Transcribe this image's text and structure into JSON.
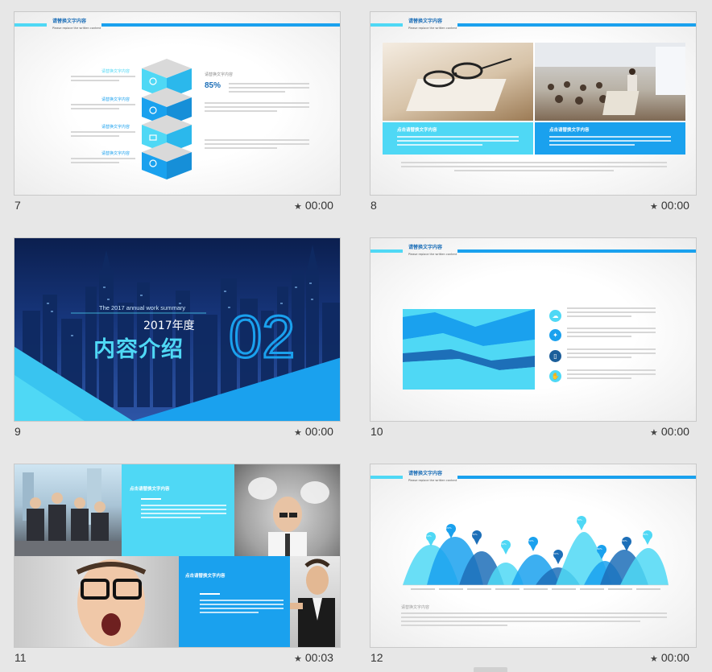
{
  "slides": [
    {
      "number": "7",
      "time": "00:00"
    },
    {
      "number": "8",
      "time": "00:00"
    },
    {
      "number": "9",
      "time": "00:00"
    },
    {
      "number": "10",
      "time": "00:00"
    },
    {
      "number": "11",
      "time": "00:03"
    },
    {
      "number": "12",
      "time": "00:00"
    }
  ],
  "slide_header": {
    "title": "请替换文字内容",
    "subtitle": "Please replace the written content"
  },
  "slide7": {
    "labels": [
      "请替换文字内容",
      "请替换文字内容",
      "请替换文字内容",
      "请替换文字内容"
    ],
    "right_title": "请替换文字内容",
    "percent": "85%"
  },
  "slide8": {
    "box_left_title": "点击请替换文字内容",
    "box_right_title": "点击请替换文字内容"
  },
  "slide9": {
    "english": "The 2017 annual work summary",
    "year": "2017年度",
    "title": "内容介绍",
    "number": "02"
  },
  "slide11": {
    "box_top_title": "点击请替换文字内容",
    "box_bottom_title": "点击请替换文字内容"
  },
  "slide12": {
    "bottom_title": "请替换文字内容",
    "pin_labels": [
      "10%",
      "20%",
      "30%",
      "40%",
      "50%",
      "60%",
      "70%",
      "80%",
      "90%",
      "95%"
    ]
  },
  "colors": {
    "accent_light": "#4fd8f5",
    "accent": "#1aa1ee",
    "accent_dark": "#1d6fb8",
    "dark_navy": "#12306b"
  },
  "icons": {
    "time": "star-icon",
    "slide10": [
      "cloud-icon",
      "bulb-icon",
      "phone-icon",
      "hand-icon"
    ],
    "slide7": [
      "link-icon",
      "people-icon",
      "chart-icon",
      "touch-icon"
    ]
  }
}
